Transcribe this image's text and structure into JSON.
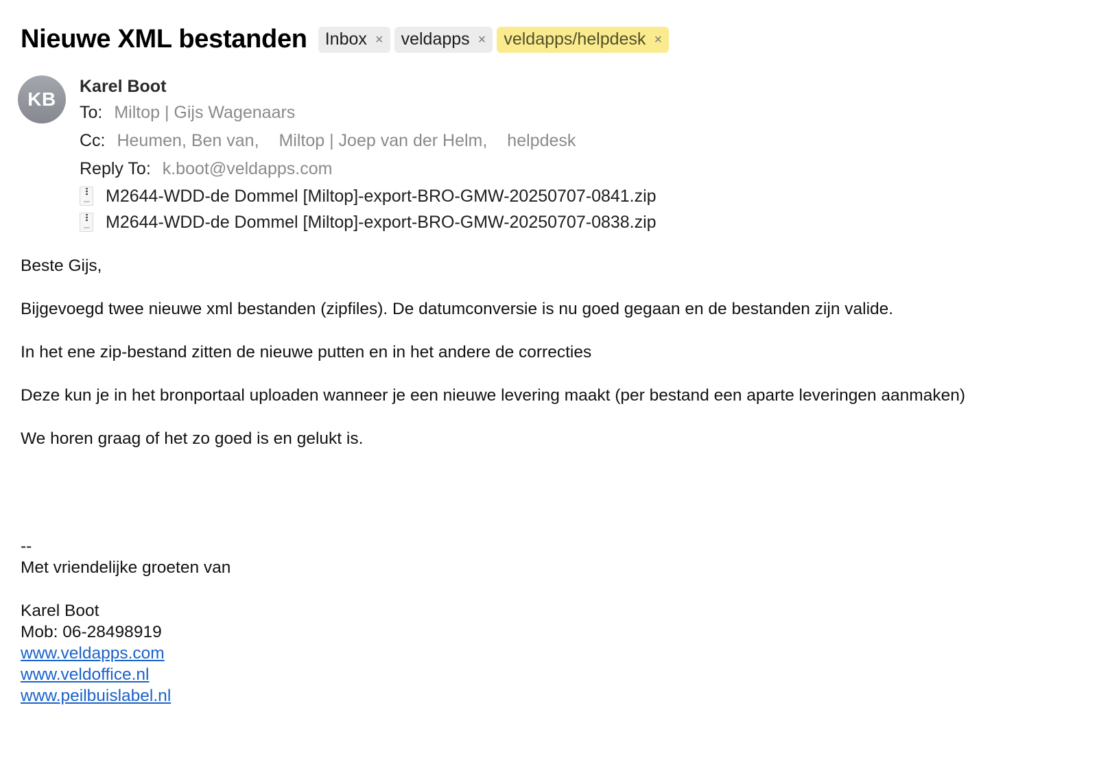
{
  "message": {
    "subject": "Nieuwe XML bestanden",
    "labels": [
      {
        "label": "Inbox",
        "close": "×",
        "color": "#ececec"
      },
      {
        "label": "veldapps",
        "close": "×",
        "color": "#ececec"
      },
      {
        "label": "veldapps/helpdesk",
        "close": "×",
        "color": "#fbeb8f"
      }
    ],
    "avatar_initials": "KB",
    "sender": "Karel Boot",
    "to_label": "To:",
    "to": [
      "Miltop | Gijs Wagenaars"
    ],
    "cc_label": "Cc:",
    "cc": [
      "Heumen, Ben van,",
      "Miltop | Joep van der Helm,",
      "helpdesk"
    ],
    "reply_to_label": "Reply To:",
    "reply_to": "k.boot@veldapps.com",
    "attachments": [
      {
        "name": "M2644-WDD-de Dommel [Miltop]-export-BRO-GMW-20250707-0841.zip",
        "icon": "zip-file-icon"
      },
      {
        "name": "M2644-WDD-de Dommel [Miltop]-export-BRO-GMW-20250707-0838.zip",
        "icon": "zip-file-icon"
      }
    ]
  },
  "body": {
    "greeting": "Beste Gijs,",
    "paragraphs": [
      "Bijgevoegd twee nieuwe xml bestanden (zipfiles). De datumconversie is nu goed gegaan en de bestanden zijn valide.",
      "In het ene zip-bestand zitten de nieuwe putten en in het andere de correcties",
      "Deze kun je in het bronportaal uploaden wanneer je een nieuwe levering maakt (per bestand een aparte leveringen aanmaken)",
      "We horen graag of het zo goed is en gelukt is."
    ],
    "signature": {
      "separator": "--",
      "closing": "Met vriendelijke groeten van",
      "name": "Karel Boot",
      "mobile": "Mob: 06-28498919",
      "links": [
        "www.veldapps.com",
        "www.veldoffice.nl",
        "www.peilbuislabel.nl"
      ]
    }
  },
  "colors": {
    "link": "#1a62c9",
    "muted": "#8a8a8e",
    "label_yellow": "#fbeb8f",
    "label_gray": "#ececec"
  }
}
